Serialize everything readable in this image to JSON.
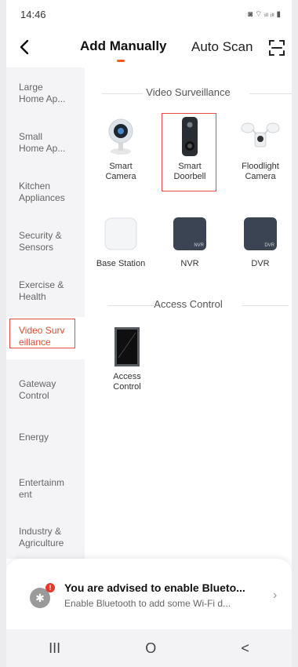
{
  "status": {
    "time": "14:46",
    "icons": "◙ ⌔ ᵢₗₗ ᵢₗₗ ▮"
  },
  "nav": {
    "active_tab": "Add Manually",
    "other_tab": "Auto Scan"
  },
  "sidebar": {
    "items": [
      {
        "label": "Large Home Ap...",
        "lines": [
          "Large",
          "Home Ap..."
        ]
      },
      {
        "label": "Small Home Ap...",
        "lines": [
          "Small",
          "Home Ap..."
        ]
      },
      {
        "label": "Kitchen Appliances",
        "lines": [
          "Kitchen",
          "Appliances"
        ]
      },
      {
        "label": "Security & Sensors",
        "lines": [
          "Security &",
          "Sensors"
        ]
      },
      {
        "label": "Exercise & Health",
        "lines": [
          "Exercise &",
          "Health"
        ]
      },
      {
        "label": "Video Surveillance",
        "lines": [
          "Video Surv",
          "eillance"
        ]
      },
      {
        "label": "Gateway Control",
        "lines": [
          "Gateway",
          "Control"
        ]
      },
      {
        "label": "Energy",
        "lines": [
          "Energy"
        ]
      },
      {
        "label": "Entertainment",
        "lines": [
          "Entertainm",
          "ent"
        ]
      },
      {
        "label": "Industry & Agriculture",
        "lines": [
          "Industry &",
          "Agriculture"
        ]
      }
    ],
    "active_index": 5
  },
  "sections": [
    {
      "title": "Video Surveillance",
      "items": [
        {
          "label": "Smart Camera",
          "lines": [
            "Smart",
            "Camera"
          ],
          "icon": "camera-icon"
        },
        {
          "label": "Smart Doorbell",
          "lines": [
            "Smart",
            "Doorbell"
          ],
          "icon": "doorbell-icon",
          "highlighted": true
        },
        {
          "label": "Floodlight Camera",
          "lines": [
            "Floodlight",
            "Camera"
          ],
          "icon": "floodlight-icon"
        },
        {
          "label": "Base Station",
          "lines": [
            "Base Station"
          ],
          "icon": "base-station-icon"
        },
        {
          "label": "NVR",
          "lines": [
            "NVR"
          ],
          "icon": "nvr-icon",
          "badge": "NVR"
        },
        {
          "label": "DVR",
          "lines": [
            "DVR"
          ],
          "icon": "dvr-icon",
          "badge": "DVR"
        }
      ]
    },
    {
      "title": "Access Control",
      "items": [
        {
          "label": "Access Control",
          "lines": [
            "Access",
            "Control"
          ],
          "icon": "access-control-icon"
        }
      ]
    }
  ],
  "banner": {
    "title": "You are advised to enable Blueto...",
    "subtitle": "Enable Bluetooth to add some Wi-Fi d...",
    "badge": "!"
  },
  "system_nav": {
    "recents": "III",
    "home": "O",
    "back": "<"
  },
  "colors": {
    "accent": "#ff5a1f",
    "highlight": "#e24c43",
    "active_text": "#e14b2c"
  }
}
